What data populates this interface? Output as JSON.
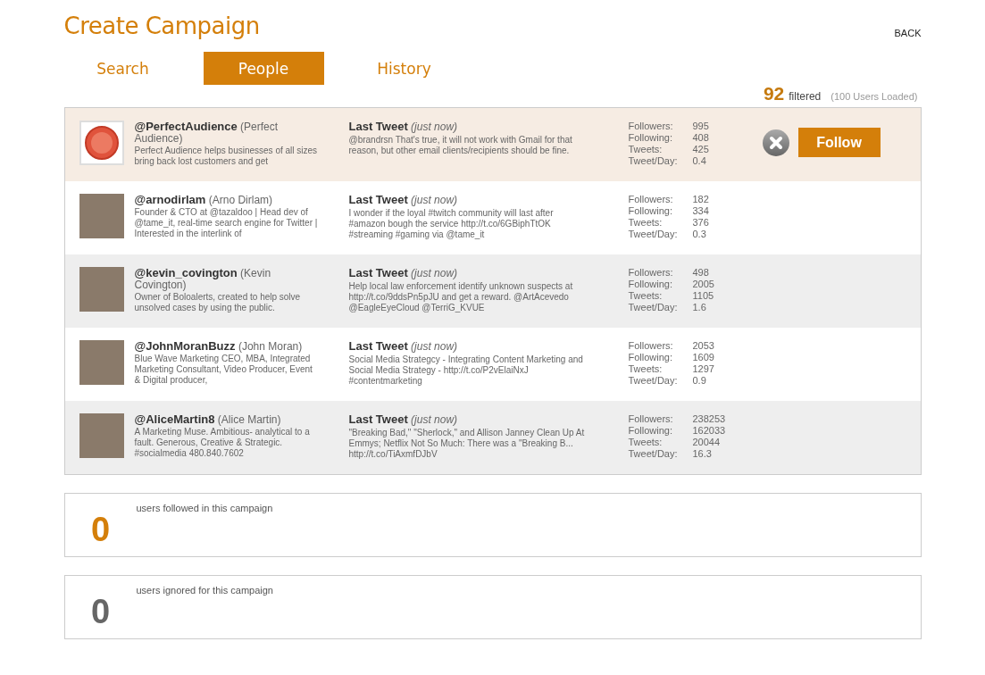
{
  "title": "Create Campaign",
  "back": "BACK",
  "tabs": [
    {
      "label": "Search",
      "selected": false
    },
    {
      "label": "People",
      "selected": true
    },
    {
      "label": "History",
      "selected": false
    }
  ],
  "filter": {
    "count": "92",
    "label": "filtered",
    "loaded": "(100 Users Loaded)"
  },
  "rows": [
    {
      "handle": "@PerfectAudience",
      "name": "(Perfect Audience)",
      "avatar": {
        "kind": "logo"
      },
      "bio": "Perfect Audience helps businesses of all sizes bring back lost customers and get",
      "tweet_label": "Last Tweet",
      "tweet_time": "(just now)",
      "tweet": "@brandrsn That's true, it will not work with Gmail for that reason, but other email clients/recipients should be fine.",
      "stats": [
        [
          "Followers:",
          "995"
        ],
        [
          "Following:",
          "408"
        ],
        [
          "Tweets:",
          "425"
        ],
        [
          "Tweet/Day:",
          "0.4"
        ]
      ],
      "selected": true,
      "follow_label": "Follow"
    },
    {
      "handle": "@arnodirlam",
      "name": "(Arno Dirlam)",
      "avatar": {
        "kind": "photo"
      },
      "bio": "Founder & CTO at @tazaldoo | Head dev of @tame_it, real-time search engine for Twitter | Interested in the interlink of",
      "tweet_label": "Last Tweet",
      "tweet_time": "(just now)",
      "tweet": "I wonder if the loyal #twitch community will last after #amazon bough the service http://t.co/6GBiphTtOK #streaming #gaming via @tame_it",
      "stats": [
        [
          "Followers:",
          "182"
        ],
        [
          "Following:",
          "334"
        ],
        [
          "Tweets:",
          "376"
        ],
        [
          "Tweet/Day:",
          "0.3"
        ]
      ],
      "selected": false
    },
    {
      "handle": "@kevin_covington",
      "name": "(Kevin Covington)",
      "avatar": {
        "kind": "photo"
      },
      "bio": "Owner of Boloalerts, created to help solve unsolved cases by using the public.",
      "tweet_label": "Last Tweet",
      "tweet_time": "(just now)",
      "tweet": "Help local law enforcement identify unknown suspects at http://t.co/9ddsPn5pJU and get a reward. @ArtAcevedo @EagleEyeCloud @TerriG_KVUE",
      "stats": [
        [
          "Followers:",
          "498"
        ],
        [
          "Following:",
          "2005"
        ],
        [
          "Tweets:",
          "1105"
        ],
        [
          "Tweet/Day:",
          "1.6"
        ]
      ],
      "selected": false
    },
    {
      "handle": "@JohnMoranBuzz",
      "name": "(John Moran)",
      "avatar": {
        "kind": "photo"
      },
      "bio": "Blue Wave Marketing CEO, MBA, Integrated Marketing Consultant, Video Producer, Event & Digital producer,",
      "tweet_label": "Last Tweet",
      "tweet_time": "(just now)",
      "tweet": "Social Media Strategcy - Integrating Content Marketing and Social Media Strategy - http://t.co/P2vElaiNxJ #contentmarketing",
      "stats": [
        [
          "Followers:",
          "2053"
        ],
        [
          "Following:",
          "1609"
        ],
        [
          "Tweets:",
          "1297"
        ],
        [
          "Tweet/Day:",
          "0.9"
        ]
      ],
      "selected": false
    },
    {
      "handle": "@AliceMartin8",
      "name": "(Alice Martin)",
      "avatar": {
        "kind": "photo"
      },
      "bio": "A Marketing Muse. Ambitious- analytical to a fault. Generous, Creative & Strategic. #socialmedia 480.840.7602",
      "tweet_label": "Last Tweet",
      "tweet_time": "(just now)",
      "tweet": "\"Breaking Bad,\" \"Sherlock,\" and Allison Janney Clean Up At Emmys; Netflix Not So Much: There was a \"Breaking B... http://t.co/TiAxmfDJbV",
      "stats": [
        [
          "Followers:",
          "238253"
        ],
        [
          "Following:",
          "162033"
        ],
        [
          "Tweets:",
          "20044"
        ],
        [
          "Tweet/Day:",
          "16.3"
        ]
      ],
      "selected": false
    }
  ],
  "summaries": [
    {
      "count": "0",
      "label": "users followed in this campaign",
      "color": "#d47f0a"
    },
    {
      "count": "0",
      "label": "users ignored for this campaign",
      "color": "#666666"
    }
  ]
}
